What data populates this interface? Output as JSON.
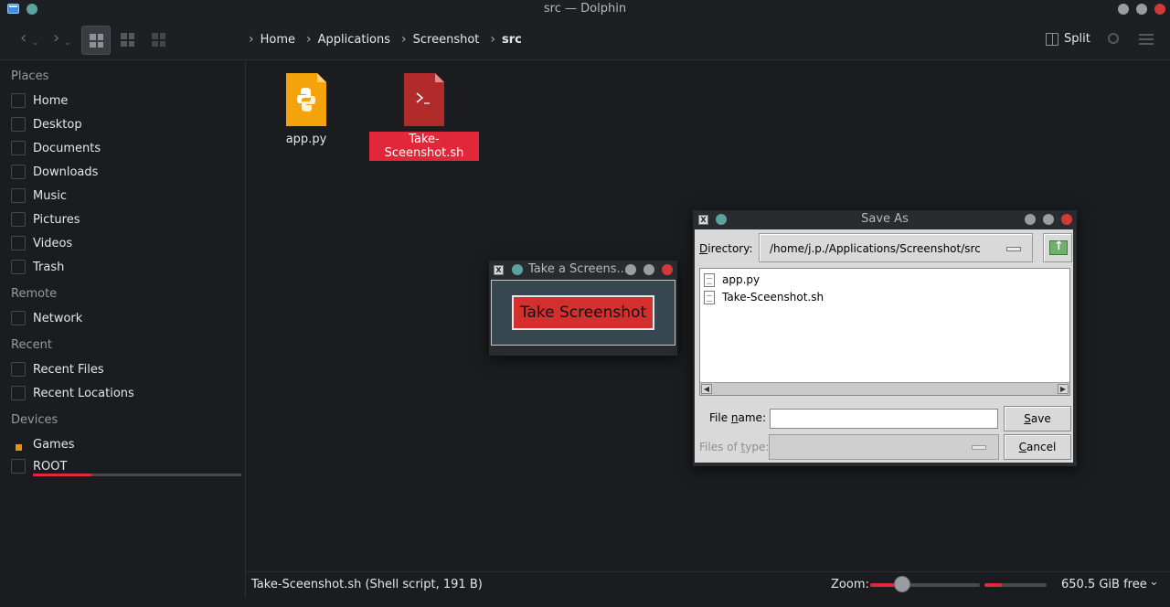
{
  "window": {
    "title": "src — Dolphin"
  },
  "breadcrumb": [
    "Home",
    "Applications",
    "Screenshot",
    "src"
  ],
  "toolbar": {
    "split_label": "Split"
  },
  "sidebar": {
    "places_title": "Places",
    "places": [
      "Home",
      "Desktop",
      "Documents",
      "Downloads",
      "Music",
      "Pictures",
      "Videos",
      "Trash"
    ],
    "remote_title": "Remote",
    "remote": [
      "Network"
    ],
    "recent_title": "Recent",
    "recent": [
      "Recent Files",
      "Recent Locations"
    ],
    "devices_title": "Devices",
    "devices": [
      "Games",
      "ROOT"
    ],
    "root_usage_fraction": 0.28
  },
  "files": [
    {
      "name": "app.py",
      "icon": "python-file-icon",
      "selected": false
    },
    {
      "name": "Take-Sceenshot.sh",
      "icon": "shell-script-icon",
      "selected": true
    }
  ],
  "statusbar": {
    "text": "Take-Sceenshot.sh (Shell script, 191 B)",
    "zoom_label": "Zoom:",
    "free_space": "650.5 GiB free"
  },
  "tk_window": {
    "title": "Take a Screens...",
    "button_label": "Take Screenshot"
  },
  "save_dialog": {
    "title": "Save As",
    "directory_label": "Directory:",
    "directory_value": "/home/j.p./Applications/Screenshot/src",
    "files": [
      "app.py",
      "Take-Sceenshot.sh"
    ],
    "file_name_label": "File name:",
    "file_name_value": "",
    "files_of_type_label": "Files of type:",
    "save_label": "Save",
    "cancel_label": "Cancel"
  },
  "colors": {
    "accent": "#e0283a",
    "tk_button": "#d32f2f",
    "tk_background": "#37474f"
  }
}
